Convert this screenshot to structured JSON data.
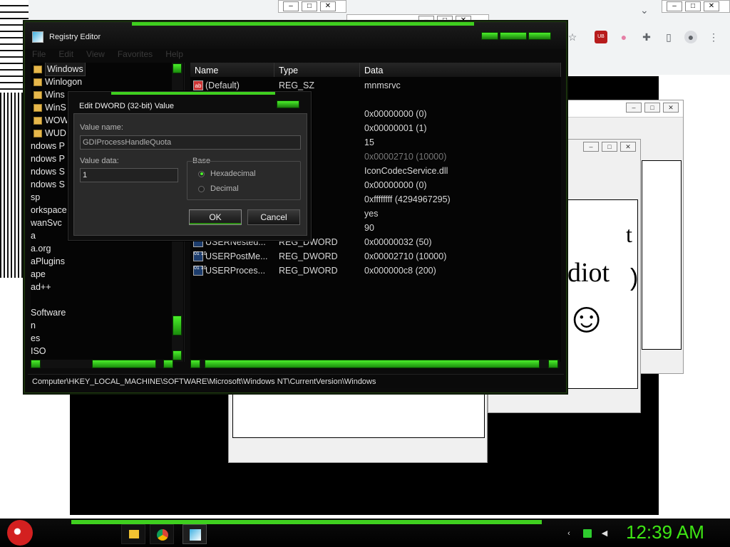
{
  "browser": {
    "restore_btn": "–",
    "max_btn": "□",
    "close_btn": "✕",
    "chevron": "⌄",
    "icons": [
      "star-icon",
      "ublock-icon",
      "flag-icon",
      "puzzle-icon",
      "sidebar-icon",
      "profile-icon",
      "menu-icon"
    ],
    "star": "☆",
    "ub": "UB",
    "flag": "●",
    "puzzle": "✚",
    "sidebar": "▯",
    "profile": "●",
    "menu": "⋮"
  },
  "popups": {
    "title_fragment": "e",
    "idiot_text": "diot",
    "t_fragment": "t",
    "smiley": "☺",
    "paren": ")"
  },
  "regedit": {
    "title": "Registry Editor",
    "menu": [
      "File",
      "Edit",
      "View",
      "Favorites",
      "Help"
    ],
    "tree": [
      {
        "label": "Windows",
        "selected": true,
        "folder": true
      },
      {
        "label": "Winlogon",
        "folder": true
      },
      {
        "label": "Wins",
        "folder": true
      },
      {
        "label": "WinS",
        "folder": true
      },
      {
        "label": "WOW",
        "folder": true
      },
      {
        "label": "WUD",
        "folder": true
      },
      {
        "label": "ndows P",
        "folder": false
      },
      {
        "label": "ndows P",
        "folder": false
      },
      {
        "label": "ndows S",
        "folder": false
      },
      {
        "label": "ndows S",
        "folder": false
      },
      {
        "label": "sp",
        "folder": false
      },
      {
        "label": "orkspace",
        "folder": false
      },
      {
        "label": "wanSvc",
        "folder": false
      },
      {
        "label": "a",
        "folder": false
      },
      {
        "label": "a.org",
        "folder": false
      },
      {
        "label": "aPlugins",
        "folder": false
      },
      {
        "label": "ape",
        "folder": false
      },
      {
        "label": "ad++",
        "folder": false
      },
      {
        "label": "",
        "folder": false
      },
      {
        "label": "Software",
        "folder": false
      },
      {
        "label": "n",
        "folder": false
      },
      {
        "label": "es",
        "folder": false
      },
      {
        "label": "ISO",
        "folder": false
      }
    ],
    "columns": {
      "name": "Name",
      "type": "Type",
      "data": "Data"
    },
    "rows": [
      {
        "name": "(Default)",
        "type": "REG_SZ",
        "data": "mnmsrvc",
        "icon": "ab"
      },
      {
        "name": "",
        "type": "Z",
        "data": "",
        "icon": ""
      },
      {
        "name": "",
        "type": "WORD",
        "data": "0x00000000 (0)",
        "icon": ""
      },
      {
        "name": "",
        "type": "WORD",
        "data": "0x00000001 (1)",
        "icon": ""
      },
      {
        "name": "",
        "type": "Z",
        "data": "15",
        "icon": ""
      },
      {
        "name": "",
        "type": "WORD",
        "data": "0x00002710 (10000)",
        "icon": "",
        "dim": true
      },
      {
        "name": "",
        "type": "Z",
        "data": "IconCodecService.dll",
        "icon": ""
      },
      {
        "name": "",
        "type": "WORD",
        "data": "0x00000000 (0)",
        "icon": ""
      },
      {
        "name": "",
        "type": "WORD",
        "data": "0xffffffff (4294967295)",
        "icon": ""
      },
      {
        "name": "",
        "type": "Z",
        "data": "yes",
        "icon": ""
      },
      {
        "name": "",
        "type": "Z",
        "data": "90",
        "icon": ""
      },
      {
        "name": "USERNested...",
        "type": "REG_DWORD",
        "data": "0x00000032 (50)",
        "icon": "dw"
      },
      {
        "name": "USERPostMe...",
        "type": "REG_DWORD",
        "data": "0x00002710 (10000)",
        "icon": "dw"
      },
      {
        "name": "USERProces...",
        "type": "REG_DWORD",
        "data": "0x000000c8 (200)",
        "icon": "dw"
      }
    ],
    "status_path": "Computer\\HKEY_LOCAL_MACHINE\\SOFTWARE\\Microsoft\\Windows NT\\CurrentVersion\\Windows"
  },
  "dialog": {
    "title": "Edit DWORD (32-bit) Value",
    "value_name_label": "Value name:",
    "value_name": "GDIProcessHandleQuota",
    "value_data_label": "Value data:",
    "value_data": "1",
    "base_label": "Base",
    "hex_label": "Hexadecimal",
    "dec_label": "Decimal",
    "selected_base": "Hexadecimal",
    "ok_label": "OK",
    "cancel_label": "Cancel"
  },
  "taskbar": {
    "clock": "12:39 AM",
    "accent": "#3ee614"
  }
}
